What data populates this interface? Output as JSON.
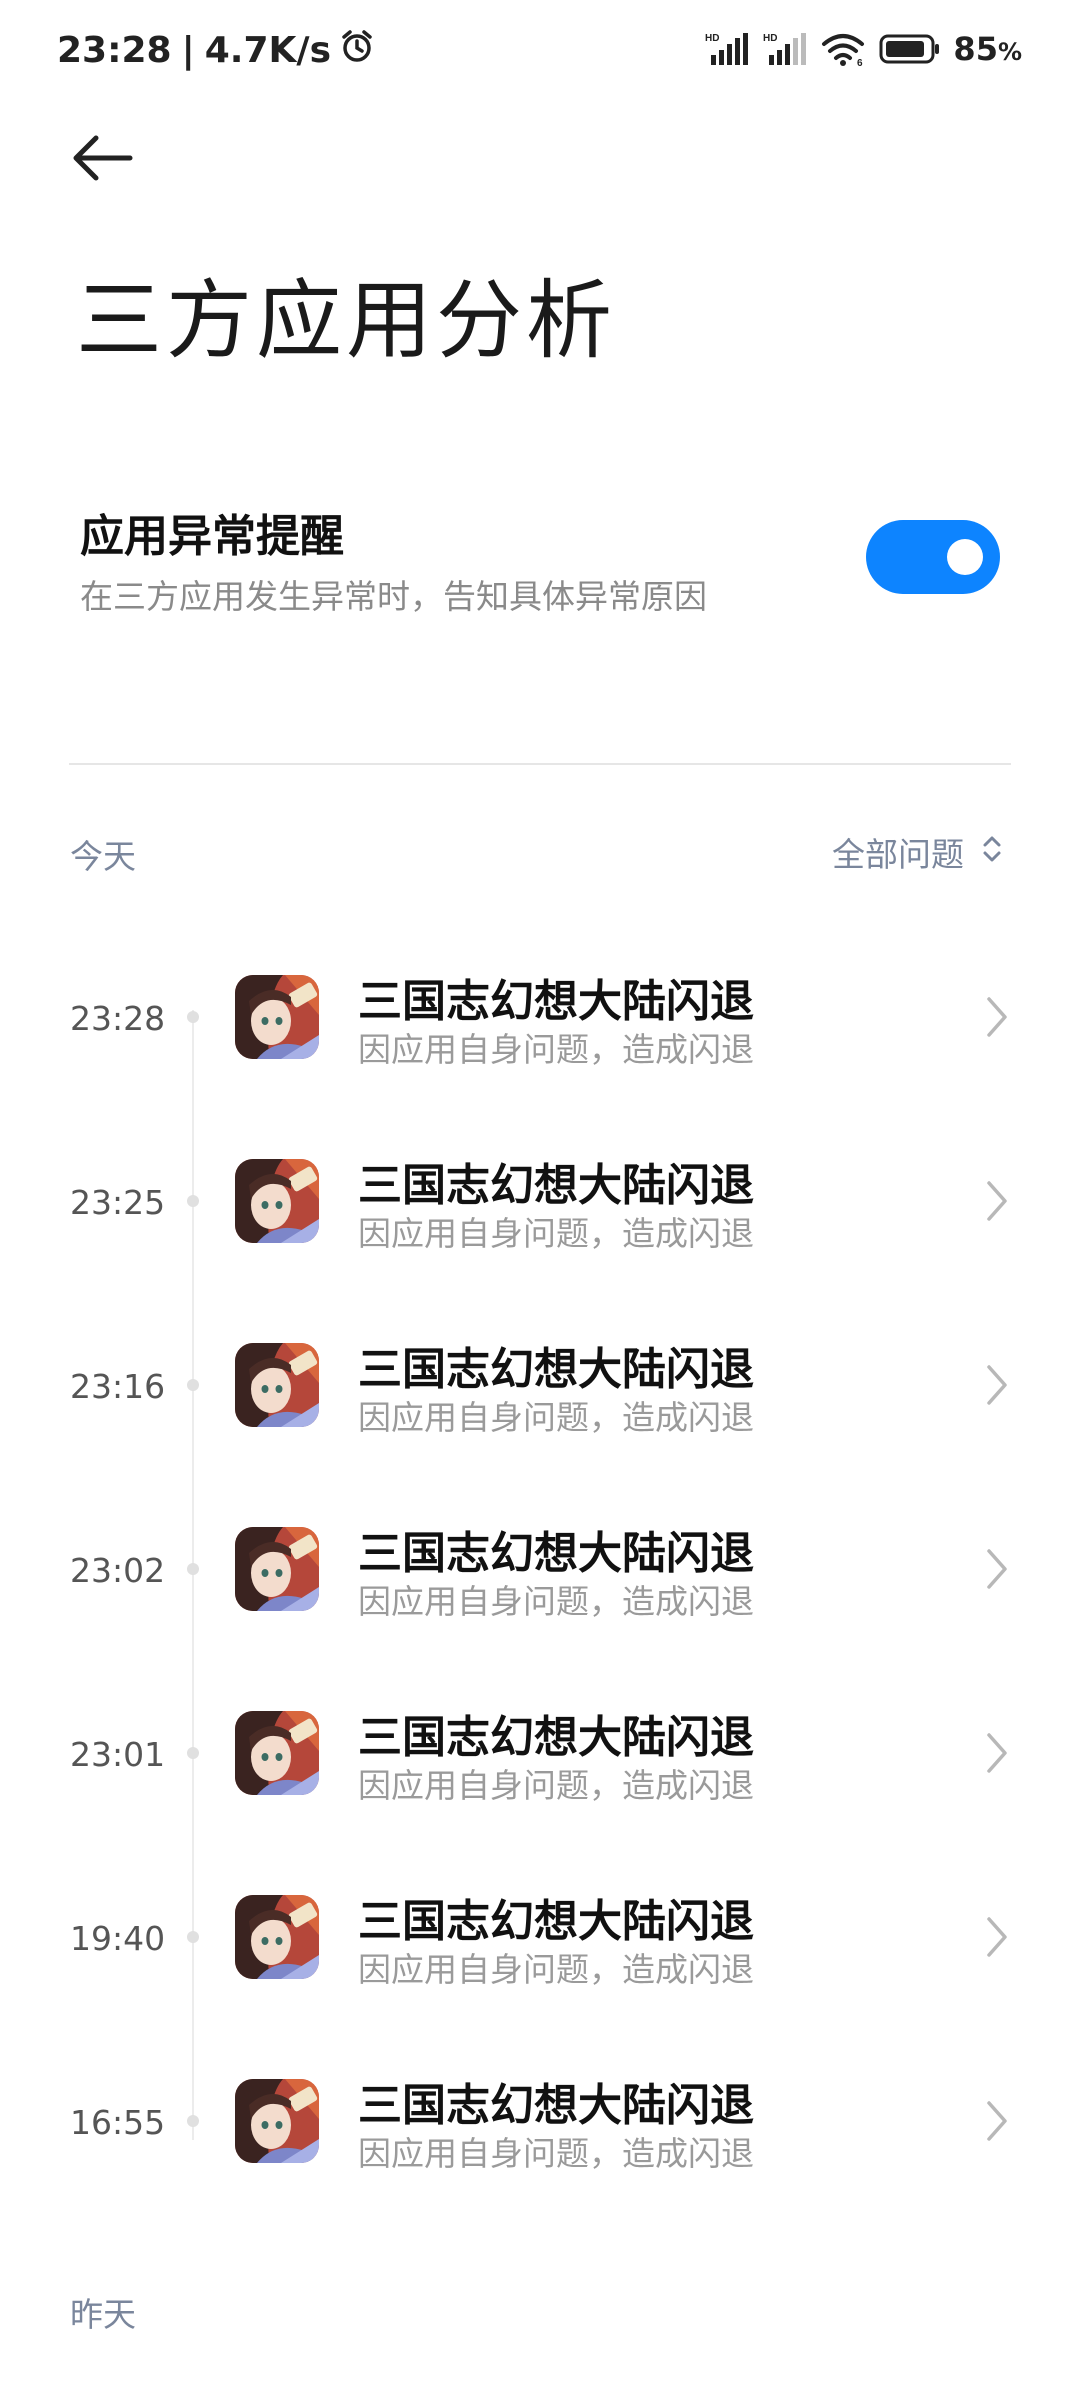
{
  "status_bar": {
    "time": "23:28",
    "network_speed": "4.7K/s",
    "battery": "85",
    "battery_unit": "%",
    "icons": [
      "alarm-icon",
      "signal-hd-icon",
      "signal-hd-icon",
      "wifi-icon",
      "battery-icon"
    ]
  },
  "header": {
    "back_icon": "arrow-left-icon",
    "title": "三方应用分析"
  },
  "setting": {
    "title": "应用异常提醒",
    "description": "在三方应用发生异常时，告知具体异常原因",
    "enabled": true
  },
  "sections": {
    "today": "今天",
    "yesterday": "昨天",
    "filter_label": "全部问题"
  },
  "records": [
    {
      "time": "23:28",
      "title": "三国志幻想大陆闪退",
      "reason": "因应用自身问题，造成闪退"
    },
    {
      "time": "23:25",
      "title": "三国志幻想大陆闪退",
      "reason": "因应用自身问题，造成闪退"
    },
    {
      "time": "23:16",
      "title": "三国志幻想大陆闪退",
      "reason": "因应用自身问题，造成闪退"
    },
    {
      "time": "23:02",
      "title": "三国志幻想大陆闪退",
      "reason": "因应用自身问题，造成闪退"
    },
    {
      "time": "23:01",
      "title": "三国志幻想大陆闪退",
      "reason": "因应用自身问题，造成闪退"
    },
    {
      "time": "19:40",
      "title": "三国志幻想大陆闪退",
      "reason": "因应用自身问题，造成闪退"
    },
    {
      "time": "16:55",
      "title": "三国志幻想大陆闪退",
      "reason": "因应用自身问题，造成闪退"
    }
  ],
  "colors": {
    "accent": "#0d84ff",
    "section_label": "#7a869c",
    "secondary_text": "#9a9a9a"
  }
}
